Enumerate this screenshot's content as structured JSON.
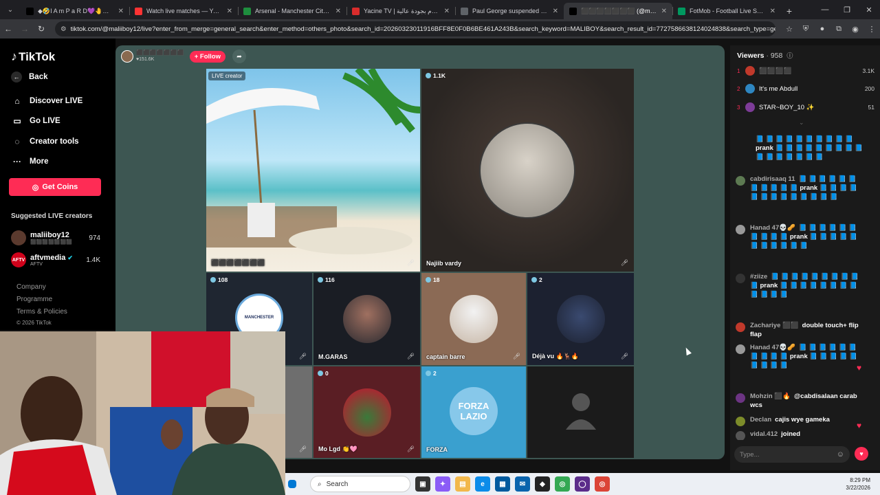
{
  "browser": {
    "tabs": [
      {
        "title": "◆🤣I A m P a R D💜🤚🎧 - d",
        "icon": "tiktok-icon",
        "color": "#000000",
        "active": false
      },
      {
        "title": "Watch live matches — Yandex",
        "icon": "yandex-icon",
        "color": "#ff3333",
        "active": false
      },
      {
        "title": "Arsenal - Manchester City (TVE",
        "icon": "sheets-icon",
        "color": "#1e8e3e",
        "active": false
      },
      {
        "title": "Yacine TV | مباريات اليوم بجودة عالية",
        "icon": "yacine-icon",
        "color": "#d92c2c",
        "active": false
      },
      {
        "title": "Paul George suspended for 25",
        "icon": "globe-icon",
        "color": "#5f6368",
        "active": false
      },
      {
        "title": "⬛⬛⬛⬛⬛⬛⬛ (@maliiboy1",
        "icon": "tiktok-icon",
        "color": "#000000",
        "active": true
      },
      {
        "title": "FotMob - Football Live Scores",
        "icon": "fotmob-icon",
        "color": "#00985f",
        "active": false
      }
    ],
    "url": "tiktok.com/@maliiboy12/live?enter_from_merge=general_search&enter_method=others_photo&search_id=20260323011916BFF8E0F0B6BE461A243B&search_keyword=MALIBOY&search_result_id=7727586638124024838&search_type=general"
  },
  "sidebar": {
    "logo": "TikTok",
    "back": "Back",
    "nav": [
      {
        "label": "Discover LIVE",
        "icon": "live-icon"
      },
      {
        "label": "Go LIVE",
        "icon": "camera-icon"
      },
      {
        "label": "Creator tools",
        "icon": "lightbulb-icon"
      },
      {
        "label": "More",
        "icon": "more-icon"
      }
    ],
    "coins_label": "Get Coins",
    "suggested_title": "Suggested LIVE creators",
    "creators": [
      {
        "name": "maliiboy12",
        "sub": "⬛⬛⬛⬛⬛⬛⬛",
        "count": "974"
      },
      {
        "name": "aftvmedia",
        "sub": "AFTV",
        "count": "1.4K"
      }
    ],
    "footer": [
      "Company",
      "Programme",
      "Terms & Policies",
      "© 2026 TikTok"
    ]
  },
  "live": {
    "host_name": "⬛⬛⬛⬛⬛⬛⬛",
    "host_likes": "151.6K",
    "follow_label": "+ Follow",
    "cells": {
      "c0": {
        "top": "LIVE creator",
        "name": "⬛⬛⬛⬛⬛⬛⬛"
      },
      "c1": {
        "top": "1.1K",
        "name": "Najiib vardy"
      },
      "c2": {
        "top": "108",
        "name": "",
        "crest": "MANCHESTER"
      },
      "c3": {
        "top": "116",
        "name": "M.GARAS"
      },
      "c4": {
        "top": "18",
        "name": "captain barre"
      },
      "c5": {
        "top": "2",
        "name": "Déjà vu 🔥🦌🔥"
      },
      "c7": {
        "top": "0",
        "name": "Mo Lgd 👏🩷"
      },
      "c8": {
        "top": "2",
        "name": "FORZA",
        "text1": "FORZA",
        "text2": "LAZIO"
      }
    }
  },
  "viewers": {
    "title": "Viewers",
    "count": "958",
    "top": [
      {
        "rank": "1",
        "name": "⬛⬛⬛⬛",
        "count": "3.1K",
        "color": "#c0392b"
      },
      {
        "rank": "2",
        "name": "It's me Abdull",
        "count": "200",
        "color": "#2e86c1"
      },
      {
        "rank": "3",
        "name": "STAR~BOY_10 ✨",
        "count": "51",
        "color": "#7d3c98"
      }
    ]
  },
  "chat": [
    {
      "user": "",
      "text": "📘 📘 📘 📘 📘 📘 📘 📘 📘 📘 prank 📘 📘 📘 📘 📘 📘 📘 📘 📘 📘 📘 📘 📘 📘 📘 📘",
      "color": "#1a1a1a"
    },
    {
      "user": "cabdirisaaq 11",
      "text": "📘 📘 📘 📘 📘 📘 📘 📘 📘 📘 📘 prank 📘 📘 📘 📘 📘 📘 📘 📘 📘 📘 📘 📘 📘",
      "color": "#5d7a52"
    },
    {
      "user": "Hanad 47💀🥜",
      "text": "📘 📘 📘 📘 📘 📘 📘 📘 📘 📘 prank 📘 📘 📘 📘 📘 📘 📘 📘 📘 📘 📘",
      "color": "#999999"
    },
    {
      "user": "#ziize",
      "text": "📘 📘 📘 📘 📘 📘 📘 📘 📘 📘 prank 📘 📘 📘 📘 📘 📘 📘 📘 📘 📘 📘 📘",
      "color": "#333333"
    },
    {
      "user": "Zachariye ⬛⬛",
      "text": "double touch+ flip flap",
      "color": "#c0392b"
    },
    {
      "user": "Hanad 47💀🥜",
      "text": "📘 📘 📘 📘 📘 📘 📘 📘 📘 📘 prank 📘 📘 📘 📘 📘 📘 📘 📘 📘",
      "color": "#999999"
    },
    {
      "user": "Mohzin ⬛🔥",
      "text": "@cabdisalaan carab wcs",
      "color": "#6c3483"
    },
    {
      "user": "Declan",
      "text": "cajis wye gameka",
      "color": "#7d8c2a"
    },
    {
      "user": "vidal.412",
      "text": "joined",
      "color": "#555555"
    }
  ],
  "chat_input": {
    "placeholder": "Type..."
  },
  "taskbar": {
    "search": "Search",
    "time": "8:29 PM",
    "date": "3/22/2026"
  }
}
